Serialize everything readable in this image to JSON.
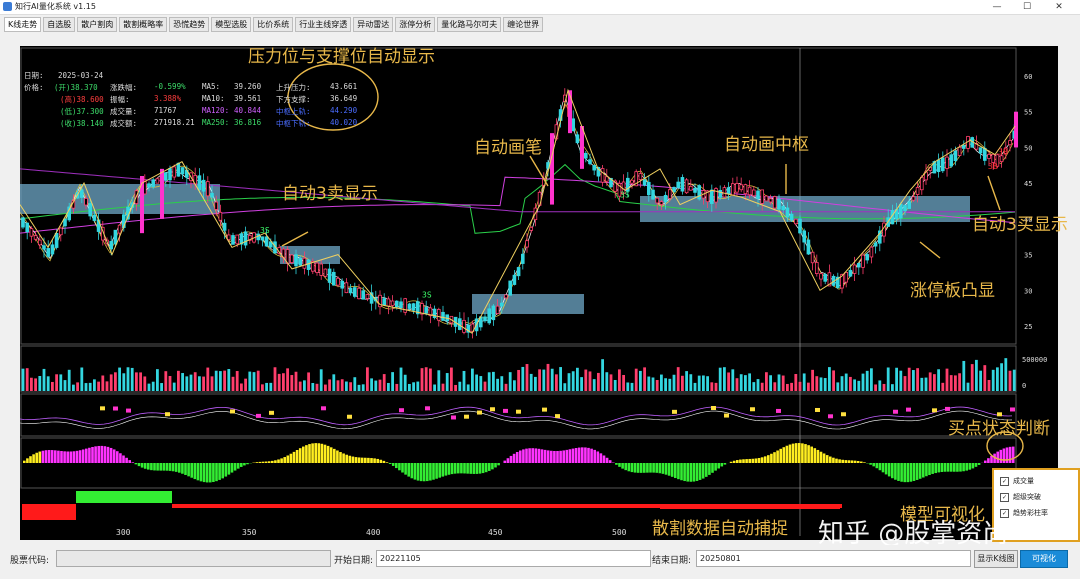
{
  "window": {
    "title": "知行AI量化系统 v1.15",
    "min": "—",
    "max": "☐",
    "close": "✕"
  },
  "tabs": [
    "K线走势",
    "自选股",
    "散户割肉",
    "散割概略率",
    "恐慌趋势",
    "模型选股",
    "比价系统",
    "行业主线穿透",
    "异动雷达",
    "涨停分析",
    "量化路马尔可夫",
    "缠论世界"
  ],
  "info": {
    "date_label": "日期:",
    "date": "2025-03-24",
    "price_label": "价格:",
    "open": "(开)38.370",
    "high": "(高)38.600",
    "low": "(低)37.300",
    "close": "(收)38.140",
    "chg_label": "涨跌幅:",
    "chg": "-0.599%",
    "amp_label": "振幅:",
    "amp": "3.388%",
    "vol_label": "成交量:",
    "vol": "71767",
    "amt_label": "成交额:",
    "amt": "271918.21",
    "ma5_label": "MA5:",
    "ma5": "39.260",
    "ma10_label": "MA10:",
    "ma10": "39.561",
    "ma120_label": "MA120:",
    "ma120": "40.844",
    "ma250_label": "MA250:",
    "ma250": "36.816",
    "up_label": "上升压力:",
    "up": "43.661",
    "down_label": "下方支撑:",
    "down": "36.649",
    "mid_up_label": "中枢上轨:",
    "mid_up": "44.290",
    "mid_down_label": "中枢下轨:",
    "mid_down": "40.020"
  },
  "annotations": {
    "a1": "压力位与支撑位自动显示",
    "a2": "自动画笔",
    "a3": "自动画中枢",
    "a4": "自动3卖显示",
    "a5": "自动3买显示",
    "a6": "涨停板凸显",
    "a7": "买点状态判断",
    "a8": "模型可视化",
    "a9": "散割数据自动捕捉"
  },
  "markers": {
    "m1": "3S",
    "m2": "3S",
    "m3": "3S",
    "m4": "3B",
    "m5": "3B"
  },
  "yaxis": [
    "60",
    "55",
    "50",
    "45",
    "40",
    "35",
    "30",
    "25"
  ],
  "vol_axis": [
    "500000",
    "0"
  ],
  "xaxis": [
    "300",
    "350",
    "400",
    "450",
    "500"
  ],
  "legend": {
    "items": [
      "成交量",
      "超级突破",
      "趋势彩柱率"
    ]
  },
  "bottom": {
    "code_label": "股票代码:",
    "code_value": "",
    "start_label": "开始日期:",
    "start_value": "20221105",
    "end_label": "结束日期:",
    "end_value": "20250801",
    "show_btn": "显示K线图",
    "vis_btn": "可视化"
  },
  "watermark": "知乎 @股掌资尚",
  "colors": {
    "up": "#ff3e6c",
    "down": "#33d6e0",
    "zone": "#6fa8c8",
    "anno": "#e8b84a"
  }
}
